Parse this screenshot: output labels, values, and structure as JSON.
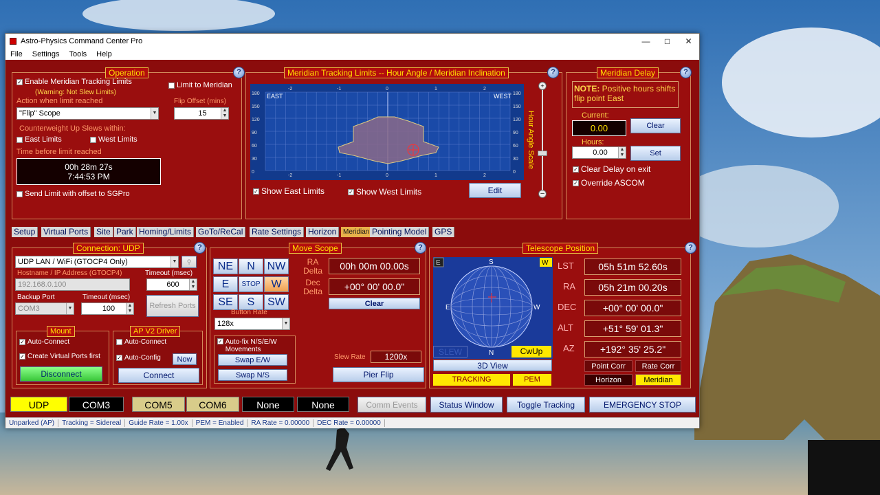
{
  "window": {
    "title": "Astro-Physics Command Center Pro"
  },
  "menu": [
    "File",
    "Settings",
    "Tools",
    "Help"
  ],
  "operation": {
    "title": "Operation",
    "enable_label": "Enable Meridian Tracking Limits",
    "warning": "(Warning: Not Slew Limits)",
    "limit_to_meridian": "Limit to Meridian",
    "action_label": "Action when limit  reached",
    "action_value": "\"Flip\" Scope",
    "flip_offset_label": "Flip Offset (mins)",
    "flip_offset_value": "15",
    "cw_label": "Counterweight Up Slews within:",
    "east_limits": "East Limits",
    "west_limits": "West Limits",
    "time_label": "Time before limit  reached",
    "time_line1": "00h 28m 27s",
    "time_line2": "7:44:53 PM",
    "send_limit": "Send Limit with offset to SGPro"
  },
  "limits": {
    "title": "Meridian Tracking Limits -- Hour Angle / Meridian Inclination",
    "east": "EAST",
    "west": "WEST",
    "x_ticks": [
      "-2",
      "-1",
      "0",
      "1",
      "2"
    ],
    "y_ticks": [
      "180",
      "150",
      "120",
      "90",
      "60",
      "30",
      "0"
    ],
    "show_east": "Show East Limits",
    "show_west": "Show West Limits",
    "edit": "Edit",
    "scale_label": "Hour Angle Scale"
  },
  "delay": {
    "title": "Meridian Delay",
    "note_bold": "NOTE:",
    "note_text": " Positive hours shifts flip point East",
    "current_label": "Current:",
    "current_value": "0.00",
    "clear": "Clear",
    "hours_label": "Hours:",
    "hours_value": "0.00",
    "set": "Set",
    "clear_on_exit": "Clear Delay on exit",
    "override": "Override ASCOM"
  },
  "tabs": [
    "Setup",
    "Virtual Ports",
    "Site",
    "Park",
    "Homing/Limits",
    "GoTo/ReCal",
    "Rate Settings",
    "Horizon",
    "Meridian",
    "Pointing Model",
    "GPS"
  ],
  "connection": {
    "title": "Connection: UDP",
    "type": "UDP LAN / WiFi (GTOCP4 Only)",
    "host_label": "Hostname / IP Address (GTOCP4)",
    "host_value": "192.168.0.100",
    "timeout_label": "Timeout (msec)",
    "timeout_value": "600",
    "backup_label": "Backup Port",
    "backup_value": "COM3",
    "timeout2_label": "Timeout (msec)",
    "timeout2_value": "100",
    "refresh": "Refresh Ports",
    "mount_title": "Mount",
    "auto_connect": "Auto-Connect",
    "create_virtual": "Create Virtual Ports first",
    "disconnect": "Disconnect",
    "ap_title": "AP V2 Driver",
    "ap_auto_connect": "Auto-Connect",
    "ap_auto_config": "Auto-Config",
    "now": "Now",
    "connect": "Connect"
  },
  "move": {
    "title": "Move Scope",
    "dirs": [
      "NE",
      "N",
      "NW",
      "E",
      "STOP",
      "W",
      "SE",
      "S",
      "SW"
    ],
    "ra_delta_label": "RA Delta",
    "ra_delta_value": "00h 00m 00.00s",
    "dec_delta_label": "Dec Delta",
    "dec_delta_value": "+00° 00' 00.0\"",
    "clear": "Clear",
    "rate_label": "Button Rate",
    "rate_value": "128x",
    "autofix": "Auto-fix N/S/E/W Movements",
    "swap_ew": "Swap E/W",
    "swap_ns": "Swap N/S",
    "slew_rate_label": "Slew Rate",
    "slew_rate_value": "1200x",
    "pier_flip": "Pier Flip"
  },
  "telescope": {
    "title": "Telescope Position",
    "rows": [
      {
        "label": "LST",
        "value": "05h 51m 52.60s"
      },
      {
        "label": "RA",
        "value": "05h 21m 00.20s"
      },
      {
        "label": "DEC",
        "value": "+00° 00' 00.0\""
      },
      {
        "label": "ALT",
        "value": "+51° 59' 01.3\""
      },
      {
        "label": "AZ",
        "value": "+192° 35' 25.2\""
      }
    ],
    "compass": {
      "s": "S",
      "n": "N",
      "e": "E",
      "w": "W",
      "e_box": "E",
      "w_box": "W"
    },
    "slew": "SLEW",
    "cwup": "CwUp",
    "view3d": "3D View",
    "tracking": "TRACKING",
    "pem": "PEM",
    "point_corr": "Point Corr",
    "rate_corr": "Rate Corr",
    "horizon": "Horizon",
    "meridian": "Meridian"
  },
  "bottom": {
    "ports": [
      "UDP",
      "COM3",
      "COM5",
      "COM6",
      "None",
      "None"
    ],
    "comm_events": "Comm Events",
    "status_window": "Status Window",
    "toggle_tracking": "Toggle Tracking",
    "emergency": "EMERGENCY STOP"
  },
  "status": [
    "Unparked (AP)",
    "Tracking = Sidereal",
    "Guide Rate = 1.00x",
    "PEM = Enabled",
    "RA Rate = 0.00000",
    "DEC Rate = 0.00000"
  ]
}
